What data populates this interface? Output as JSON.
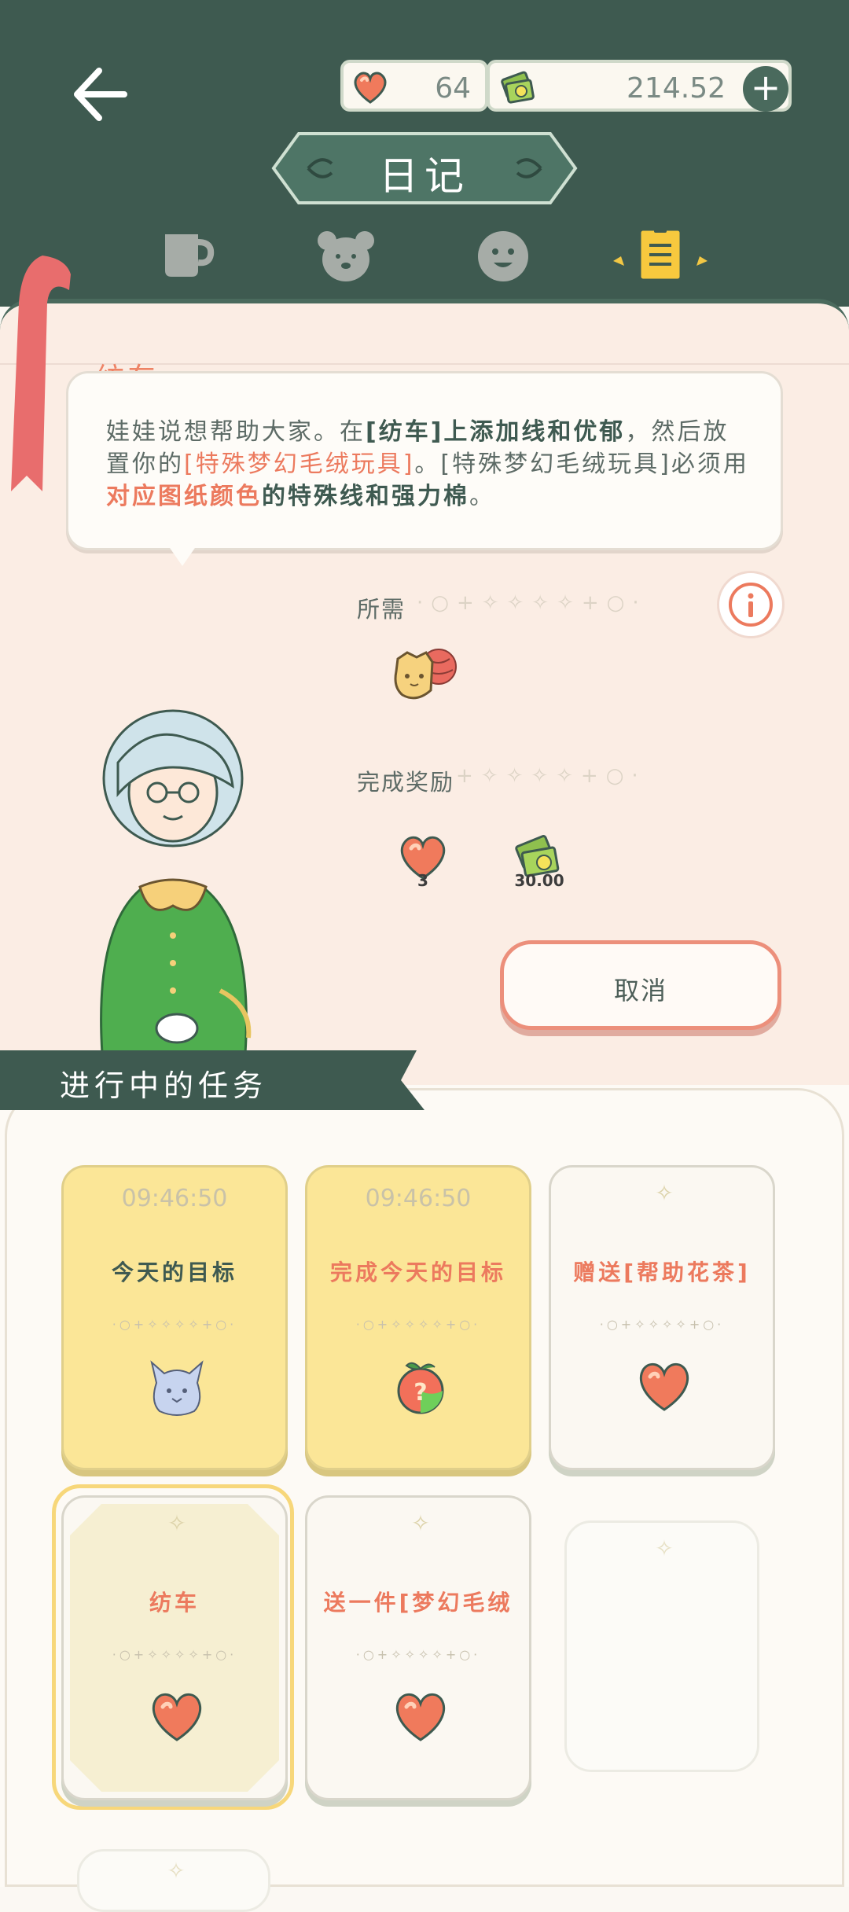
{
  "header": {
    "title": "日记",
    "hearts": "64",
    "money": "214.52",
    "plus_label": "+",
    "tabs": [
      "cup-tab",
      "bear-tab",
      "smile-tab",
      "diary-tab"
    ],
    "active_tab": "diary-tab"
  },
  "task_detail": {
    "section_title": "纺车",
    "description_parts": {
      "p1": "娃娃说想帮助大家。在",
      "p2": "[纺车]上添加线和优郁",
      "p3": "，然后放置你的",
      "p4": "[特殊梦幻毛绒玩具]",
      "p5": "。[特殊梦幻毛绒玩具]必须用",
      "p6": "对应图纸颜色",
      "p7": "的特殊线和强力棉",
      "p8": "。"
    },
    "required_label": "所需",
    "reward_label": "完成奖励",
    "reward_heart_value": "3",
    "reward_money_value": "30.00",
    "cancel_label": "取消",
    "info_icon": "info-icon"
  },
  "tasks": {
    "section_title": "进行中的任务",
    "cards": [
      {
        "timer": "09:46:50",
        "title": "今天的目标",
        "title_color": "#3f5a51",
        "style": "yellow",
        "icon": "ghost-icon"
      },
      {
        "timer": "09:46:50",
        "title": "完成今天的目标",
        "title_color": "#ec7a5e",
        "style": "yellow",
        "icon": "mystery-fruit-icon"
      },
      {
        "timer": "",
        "title": "赠送[帮助花茶]",
        "title_color": "#ec7a5e",
        "style": "white",
        "icon": "heart-icon"
      },
      {
        "timer": "",
        "title": "纺车",
        "title_color": "#ec7a5e",
        "style": "selected",
        "icon": "heart-icon"
      },
      {
        "timer": "",
        "title": "送一件[梦幻毛绒",
        "title_color": "#ec7a5e",
        "style": "white",
        "icon": "heart-icon"
      }
    ]
  },
  "colors": {
    "accent": "#3e5a50",
    "orange": "#ec7a5e",
    "yellow": "#fbe697"
  }
}
